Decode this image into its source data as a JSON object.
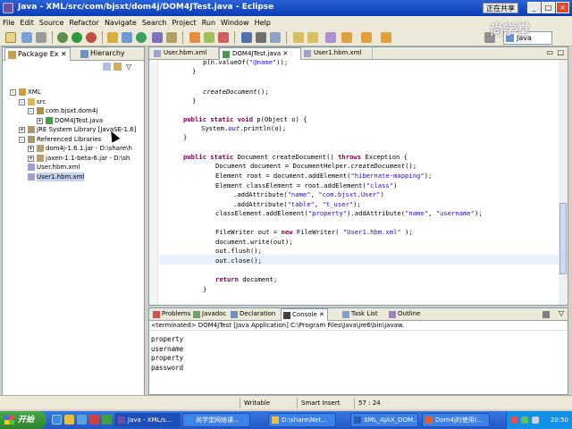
{
  "window": {
    "title": "Java - XML/src/com/bjsxt/dom4j/DOM4JTest.java - Eclipse",
    "badge": "正在共享",
    "min": "_",
    "max": "□",
    "close": "×"
  },
  "menu": [
    "File",
    "Edit",
    "Source",
    "Refactor",
    "Navigate",
    "Search",
    "Project",
    "Run",
    "Window",
    "Help"
  ],
  "perspective": "Java",
  "watermark": "尚学堂",
  "left": {
    "tabs": [
      "Package Ex",
      "Hierarchy"
    ],
    "tree": [
      {
        "label": "XML",
        "indent": 0,
        "twisty": "-",
        "icon": "project-icon"
      },
      {
        "label": "src",
        "indent": 1,
        "twisty": "-",
        "icon": "source-folder-icon"
      },
      {
        "label": "com.bjsxt.dom4j",
        "indent": 2,
        "twisty": "-",
        "icon": "package-icon"
      },
      {
        "label": "DOM4JTest.java",
        "indent": 3,
        "twisty": "+",
        "icon": "java-file-icon"
      },
      {
        "label": "JRE System Library [JavaSE-1.6]",
        "indent": 1,
        "twisty": "+",
        "icon": "library-icon"
      },
      {
        "label": "Referenced Libraries",
        "indent": 1,
        "twisty": "-",
        "icon": "library-icon"
      },
      {
        "label": "dom4j-1.6.1.jar - D:\\share\\h",
        "indent": 2,
        "twisty": "+",
        "icon": "jar-icon"
      },
      {
        "label": "jaxen-1.1-beta-6.jar - D:\\sh",
        "indent": 2,
        "twisty": "+",
        "icon": "jar-icon"
      },
      {
        "label": "User.hbm.xml",
        "indent": 1,
        "twisty": "",
        "icon": "xml-file-icon"
      },
      {
        "label": "User1.hbm.xml",
        "indent": 1,
        "twisty": "",
        "icon": "xml-file-icon"
      }
    ]
  },
  "editor": {
    "tabs": [
      "User.hbm.xml",
      "DOM4JTest.java",
      "User1.hbm.xml"
    ],
    "active_tab": 1
  },
  "bottom": {
    "tabs": [
      "Problems",
      "Javadoc",
      "Declaration",
      "Console",
      "Task List",
      "Outline"
    ],
    "active_tab": 3,
    "console_header": "<terminated> DOM4JTest [Java Application] C:\\Program Files\\Java\\jre6\\bin\\javaw.",
    "output": [
      "property",
      "username",
      "property",
      "password"
    ]
  },
  "status": {
    "writable": "Writable",
    "insert_mode": "Smart Insert",
    "position": "57 : 24"
  },
  "taskbar": {
    "start": "开始",
    "tasks": [
      "Java - XML/s...",
      "尚学堂网络课...",
      "D:\\share\\Net...",
      "XML_AJAX_DOM...",
      "Dom4j的使用(..."
    ],
    "active_task": 0,
    "clock": "20:50"
  },
  "colors": {
    "keyword": "#7f0055",
    "string": "#2a00ff",
    "field": "#0000c0",
    "current_line": "#e8f2fe"
  }
}
